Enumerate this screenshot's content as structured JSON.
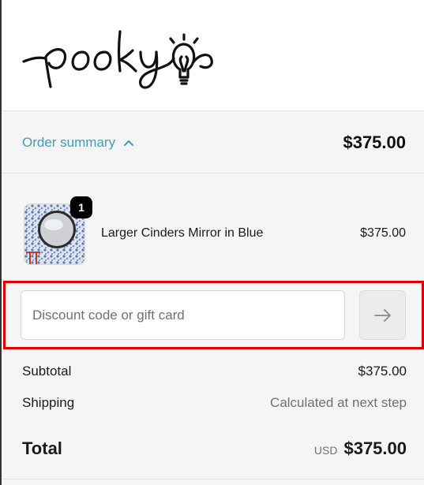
{
  "brand": {
    "logo_text": "pooky"
  },
  "summary": {
    "toggle_label": "Order summary",
    "total": "$375.00"
  },
  "item": {
    "name": "Larger Cinders Mirror in Blue",
    "price": "$375.00",
    "quantity": "1"
  },
  "discount": {
    "placeholder": "Discount code or gift card"
  },
  "totals": {
    "subtotal_label": "Subtotal",
    "subtotal_value": "$375.00",
    "shipping_label": "Shipping",
    "shipping_value": "Calculated at next step",
    "total_label": "Total",
    "currency": "USD",
    "total_value": "$375.00"
  },
  "colors": {
    "accent": "#3e9ebf",
    "highlight_border": "#e00000"
  }
}
